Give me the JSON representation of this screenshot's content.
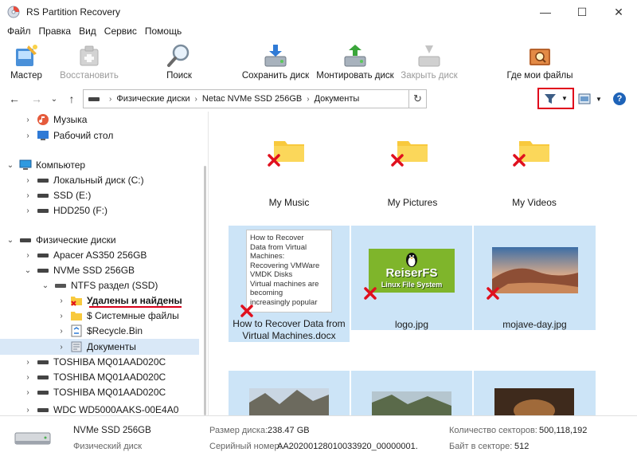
{
  "window": {
    "title": "RS Partition Recovery",
    "minimize": "—",
    "maximize": "☐",
    "close": "✕"
  },
  "menu": [
    "Файл",
    "Правка",
    "Вид",
    "Сервис",
    "Помощь"
  ],
  "toolbar": {
    "master": "Мастер",
    "restore": "Восстановить",
    "search": "Поиск",
    "save_disk": "Сохранить диск",
    "mount_disk": "Монтировать диск",
    "close_disk": "Закрыть диск",
    "where_files": "Где мои файлы"
  },
  "address": {
    "segments": [
      "Физические диски",
      "Netac NVMe SSD 256GB",
      "Документы"
    ]
  },
  "tree": {
    "items": [
      {
        "label": "Музыка"
      },
      {
        "label": "Рабочий стол"
      },
      {
        "label": "Компьютер"
      },
      {
        "label": "Локальный диск (C:)"
      },
      {
        "label": "SSD (E:)"
      },
      {
        "label": "HDD250 (F:)"
      },
      {
        "label": "Физические диски"
      },
      {
        "label": "Apacer AS350 256GB"
      },
      {
        "label": "NVMe SSD 256GB"
      },
      {
        "label": "NTFS раздел (SSD)"
      },
      {
        "label": "Удалены и найдены"
      },
      {
        "label": "$ Системные файлы"
      },
      {
        "label": "$Recycle.Bin"
      },
      {
        "label": "Документы"
      },
      {
        "label": "TOSHIBA MQ01AAD020C"
      },
      {
        "label": "TOSHIBA MQ01AAD020C"
      },
      {
        "label": "TOSHIBA MQ01AAD020C"
      },
      {
        "label": "WDC WD5000AAKS-00E4A0"
      }
    ]
  },
  "files": [
    {
      "name": "My Music"
    },
    {
      "name": "My Pictures"
    },
    {
      "name": "My Videos"
    },
    {
      "name_line1": "How to Recover Data from",
      "name_line2": "Virtual Machines.docx",
      "preview": [
        "How to Recover",
        "Data from Virtual",
        "Machines:",
        "Recovering VMWare",
        "VMDK Disks",
        "Virtual machines are",
        "becoming",
        "increasingly popular"
      ]
    },
    {
      "name": "logo.jpg",
      "logo_title": "ReiserFS",
      "logo_sub": "Linux File System"
    },
    {
      "name": "mojave-day.jpg"
    }
  ],
  "status": {
    "disk_name": "NVMe SSD 256GB",
    "disk_type": "Физический диск",
    "size_label": "Размер диска:",
    "size_value": "238.47 GB",
    "serial_label": "Серийный номер:",
    "serial_value": "AA202001280100339​20_00000001.",
    "sectors_label": "Количество секторов:",
    "sectors_value": "500,118,192",
    "bps_label": "Байт в секторе:",
    "bps_value": "512"
  }
}
